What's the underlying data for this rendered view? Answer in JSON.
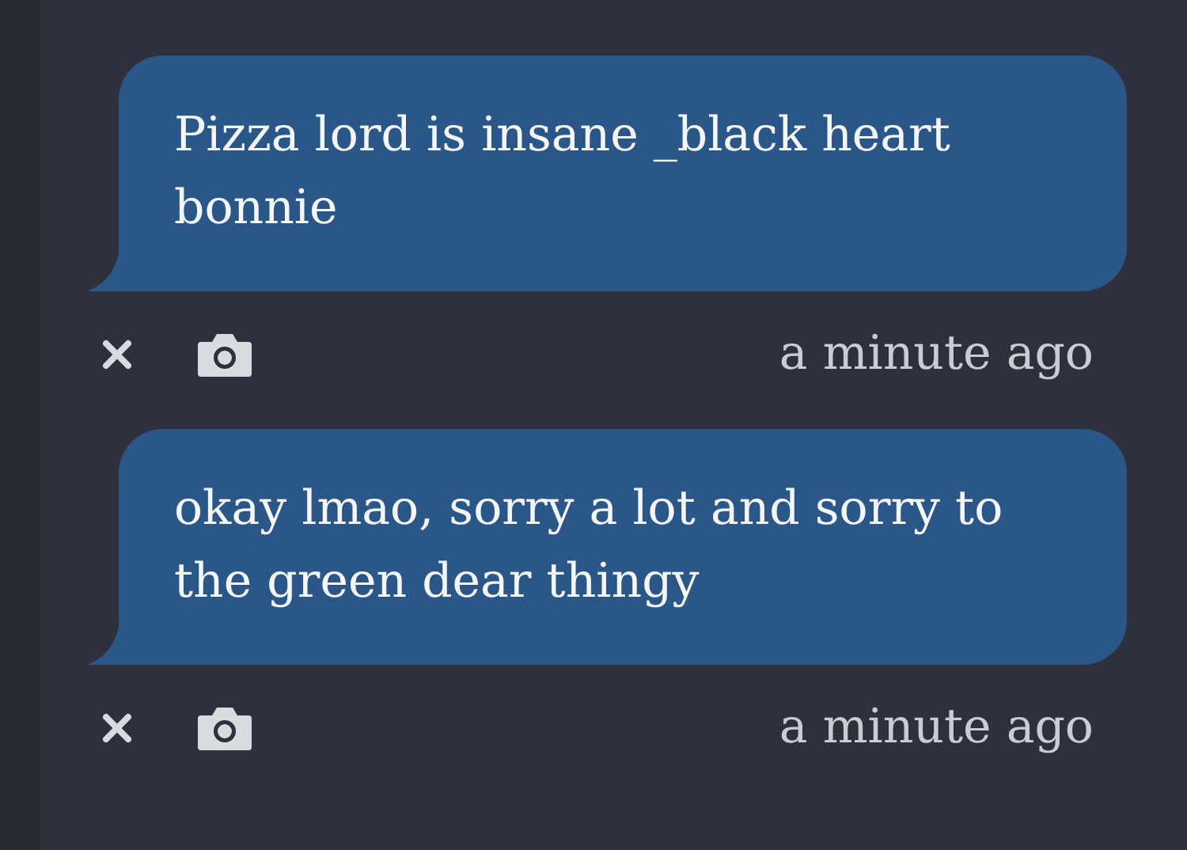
{
  "messages": [
    {
      "text": "Pizza lord is insane _black heart bonnie",
      "time": "a minute ago"
    },
    {
      "text": "okay lmao, sorry a lot and sorry to the green dear thingy",
      "time": "a minute ago"
    }
  ]
}
